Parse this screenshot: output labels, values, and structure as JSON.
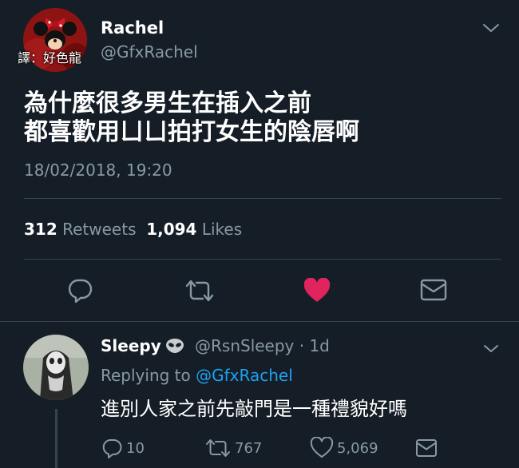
{
  "main_tweet": {
    "author_name": "Rachel",
    "author_handle": "@GfxRachel",
    "avatar_watermark": "譯：好色龍",
    "text_lines": [
      "為什麼很多男生在插入之前",
      "都喜歡用ㄩㄩ拍打女生的陰唇啊"
    ],
    "timestamp": "18/02/2018, 19:20",
    "retweets_count": "312",
    "retweets_label": "Retweets",
    "likes_count": "1,094",
    "likes_label": "Likes",
    "icons": {
      "reply": "reply-icon",
      "retweet": "retweet-icon",
      "like": "heart-icon",
      "message": "envelope-icon",
      "menu": "chevron-down-icon"
    }
  },
  "reply_tweet": {
    "author_name": "Sleepy",
    "author_badge": "alien-icon",
    "author_handle": "@RsnSleepy · 1d",
    "replying_prefix": "Replying to",
    "replying_to": "@GfxRachel",
    "text": "進別人家之前先敲門是一種禮貌好嗎",
    "reply_count": "10",
    "retweet_count": "767",
    "like_count": "5,069"
  },
  "colors": {
    "background": "#151e27",
    "secondary_text": "#8899a6",
    "link": "#1da1f2",
    "like_active": "#e0245e",
    "divider": "#38444d"
  }
}
